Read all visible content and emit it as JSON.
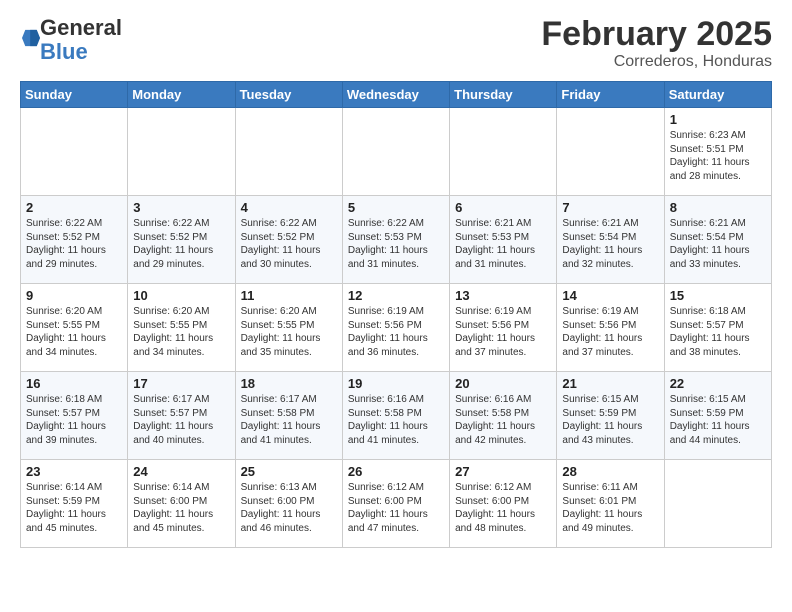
{
  "logo": {
    "general": "General",
    "blue": "Blue"
  },
  "title": "February 2025",
  "subtitle": "Correderos, Honduras",
  "days_of_week": [
    "Sunday",
    "Monday",
    "Tuesday",
    "Wednesday",
    "Thursday",
    "Friday",
    "Saturday"
  ],
  "weeks": [
    [
      {
        "day": "",
        "info": ""
      },
      {
        "day": "",
        "info": ""
      },
      {
        "day": "",
        "info": ""
      },
      {
        "day": "",
        "info": ""
      },
      {
        "day": "",
        "info": ""
      },
      {
        "day": "",
        "info": ""
      },
      {
        "day": "1",
        "info": "Sunrise: 6:23 AM\nSunset: 5:51 PM\nDaylight: 11 hours\nand 28 minutes."
      }
    ],
    [
      {
        "day": "2",
        "info": "Sunrise: 6:22 AM\nSunset: 5:52 PM\nDaylight: 11 hours\nand 29 minutes."
      },
      {
        "day": "3",
        "info": "Sunrise: 6:22 AM\nSunset: 5:52 PM\nDaylight: 11 hours\nand 29 minutes."
      },
      {
        "day": "4",
        "info": "Sunrise: 6:22 AM\nSunset: 5:52 PM\nDaylight: 11 hours\nand 30 minutes."
      },
      {
        "day": "5",
        "info": "Sunrise: 6:22 AM\nSunset: 5:53 PM\nDaylight: 11 hours\nand 31 minutes."
      },
      {
        "day": "6",
        "info": "Sunrise: 6:21 AM\nSunset: 5:53 PM\nDaylight: 11 hours\nand 31 minutes."
      },
      {
        "day": "7",
        "info": "Sunrise: 6:21 AM\nSunset: 5:54 PM\nDaylight: 11 hours\nand 32 minutes."
      },
      {
        "day": "8",
        "info": "Sunrise: 6:21 AM\nSunset: 5:54 PM\nDaylight: 11 hours\nand 33 minutes."
      }
    ],
    [
      {
        "day": "9",
        "info": "Sunrise: 6:20 AM\nSunset: 5:55 PM\nDaylight: 11 hours\nand 34 minutes."
      },
      {
        "day": "10",
        "info": "Sunrise: 6:20 AM\nSunset: 5:55 PM\nDaylight: 11 hours\nand 34 minutes."
      },
      {
        "day": "11",
        "info": "Sunrise: 6:20 AM\nSunset: 5:55 PM\nDaylight: 11 hours\nand 35 minutes."
      },
      {
        "day": "12",
        "info": "Sunrise: 6:19 AM\nSunset: 5:56 PM\nDaylight: 11 hours\nand 36 minutes."
      },
      {
        "day": "13",
        "info": "Sunrise: 6:19 AM\nSunset: 5:56 PM\nDaylight: 11 hours\nand 37 minutes."
      },
      {
        "day": "14",
        "info": "Sunrise: 6:19 AM\nSunset: 5:56 PM\nDaylight: 11 hours\nand 37 minutes."
      },
      {
        "day": "15",
        "info": "Sunrise: 6:18 AM\nSunset: 5:57 PM\nDaylight: 11 hours\nand 38 minutes."
      }
    ],
    [
      {
        "day": "16",
        "info": "Sunrise: 6:18 AM\nSunset: 5:57 PM\nDaylight: 11 hours\nand 39 minutes."
      },
      {
        "day": "17",
        "info": "Sunrise: 6:17 AM\nSunset: 5:57 PM\nDaylight: 11 hours\nand 40 minutes."
      },
      {
        "day": "18",
        "info": "Sunrise: 6:17 AM\nSunset: 5:58 PM\nDaylight: 11 hours\nand 41 minutes."
      },
      {
        "day": "19",
        "info": "Sunrise: 6:16 AM\nSunset: 5:58 PM\nDaylight: 11 hours\nand 41 minutes."
      },
      {
        "day": "20",
        "info": "Sunrise: 6:16 AM\nSunset: 5:58 PM\nDaylight: 11 hours\nand 42 minutes."
      },
      {
        "day": "21",
        "info": "Sunrise: 6:15 AM\nSunset: 5:59 PM\nDaylight: 11 hours\nand 43 minutes."
      },
      {
        "day": "22",
        "info": "Sunrise: 6:15 AM\nSunset: 5:59 PM\nDaylight: 11 hours\nand 44 minutes."
      }
    ],
    [
      {
        "day": "23",
        "info": "Sunrise: 6:14 AM\nSunset: 5:59 PM\nDaylight: 11 hours\nand 45 minutes."
      },
      {
        "day": "24",
        "info": "Sunrise: 6:14 AM\nSunset: 6:00 PM\nDaylight: 11 hours\nand 45 minutes."
      },
      {
        "day": "25",
        "info": "Sunrise: 6:13 AM\nSunset: 6:00 PM\nDaylight: 11 hours\nand 46 minutes."
      },
      {
        "day": "26",
        "info": "Sunrise: 6:12 AM\nSunset: 6:00 PM\nDaylight: 11 hours\nand 47 minutes."
      },
      {
        "day": "27",
        "info": "Sunrise: 6:12 AM\nSunset: 6:00 PM\nDaylight: 11 hours\nand 48 minutes."
      },
      {
        "day": "28",
        "info": "Sunrise: 6:11 AM\nSunset: 6:01 PM\nDaylight: 11 hours\nand 49 minutes."
      },
      {
        "day": "",
        "info": ""
      }
    ]
  ]
}
